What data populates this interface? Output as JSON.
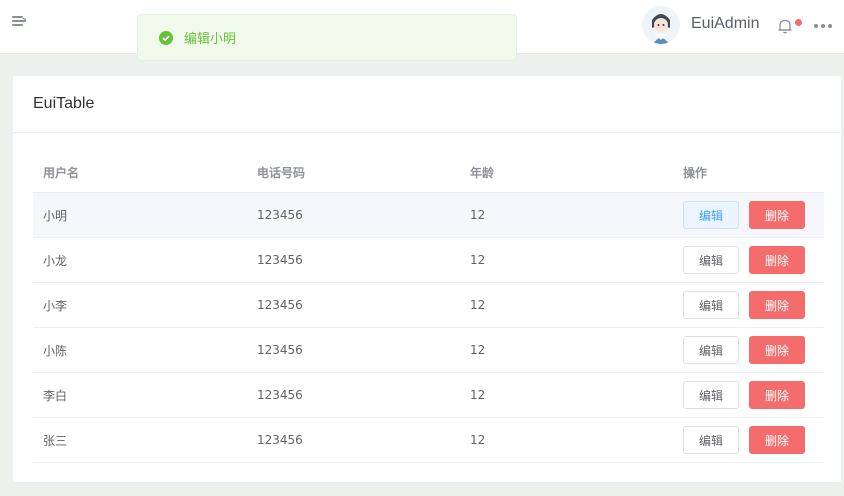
{
  "header": {
    "username": "EuiAdmin"
  },
  "toast": {
    "message": "编辑小明",
    "type": "success"
  },
  "card": {
    "title": "EuiTable"
  },
  "table": {
    "columns": [
      "用户名",
      "电话号码",
      "年龄",
      "操作"
    ],
    "rows": [
      {
        "name": "小明",
        "phone": "123456",
        "age": "12"
      },
      {
        "name": "小龙",
        "phone": "123456",
        "age": "12"
      },
      {
        "name": "小李",
        "phone": "123456",
        "age": "12"
      },
      {
        "name": "小陈",
        "phone": "123456",
        "age": "12"
      },
      {
        "name": "李白",
        "phone": "123456",
        "age": "12"
      },
      {
        "name": "张三",
        "phone": "123456",
        "age": "12"
      }
    ],
    "edit_label": "编辑",
    "delete_label": "删除"
  },
  "colors": {
    "success": "#67c23a",
    "danger": "#f56c6c",
    "primary": "#409eff"
  }
}
